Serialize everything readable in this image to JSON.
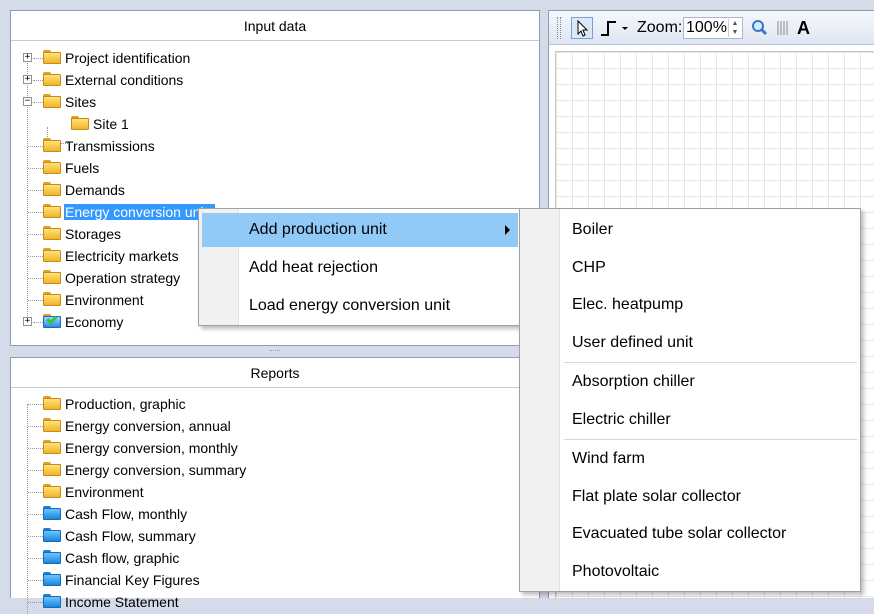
{
  "input_panel": {
    "title": "Input data",
    "items": [
      {
        "label": "Project identification"
      },
      {
        "label": "External conditions"
      },
      {
        "label": "Sites"
      },
      {
        "label": "Site 1"
      },
      {
        "label": "Transmissions"
      },
      {
        "label": "Fuels"
      },
      {
        "label": "Demands"
      },
      {
        "label": "Energy conversion units"
      },
      {
        "label": "Storages"
      },
      {
        "label": "Electricity markets"
      },
      {
        "label": "Operation strategy"
      },
      {
        "label": "Environment"
      },
      {
        "label": "Economy"
      }
    ]
  },
  "reports_panel": {
    "title": "Reports",
    "items": [
      {
        "label": "Production, graphic"
      },
      {
        "label": "Energy conversion, annual"
      },
      {
        "label": "Energy conversion, monthly"
      },
      {
        "label": "Energy conversion, summary"
      },
      {
        "label": "Environment"
      },
      {
        "label": "Cash Flow, monthly"
      },
      {
        "label": "Cash Flow, summary"
      },
      {
        "label": "Cash flow, graphic"
      },
      {
        "label": "Financial Key Figures"
      },
      {
        "label": "Income Statement"
      }
    ]
  },
  "toolbar": {
    "zoom_label": "Zoom:",
    "zoom_value": "100%",
    "text_tool": "A"
  },
  "context_menu": {
    "items": [
      {
        "label": "Add production unit"
      },
      {
        "label": "Add heat rejection"
      },
      {
        "label": "Load energy conversion unit"
      }
    ]
  },
  "submenu": {
    "items": [
      {
        "label": "Boiler"
      },
      {
        "label": "CHP"
      },
      {
        "label": "Elec. heatpump"
      },
      {
        "label": "User defined unit"
      },
      {
        "label": "Absorption chiller"
      },
      {
        "label": "Electric chiller"
      },
      {
        "label": "Wind farm"
      },
      {
        "label": "Flat plate solar collector"
      },
      {
        "label": "Evacuated tube solar collector"
      },
      {
        "label": "Photovoltaic"
      }
    ]
  },
  "colors": {
    "selection": "#3399ff",
    "menu_highlight": "#91c9f7",
    "folder_yellow": "#f2b42a",
    "folder_blue": "#1a86de",
    "panel_border": "#8e9cb6"
  }
}
